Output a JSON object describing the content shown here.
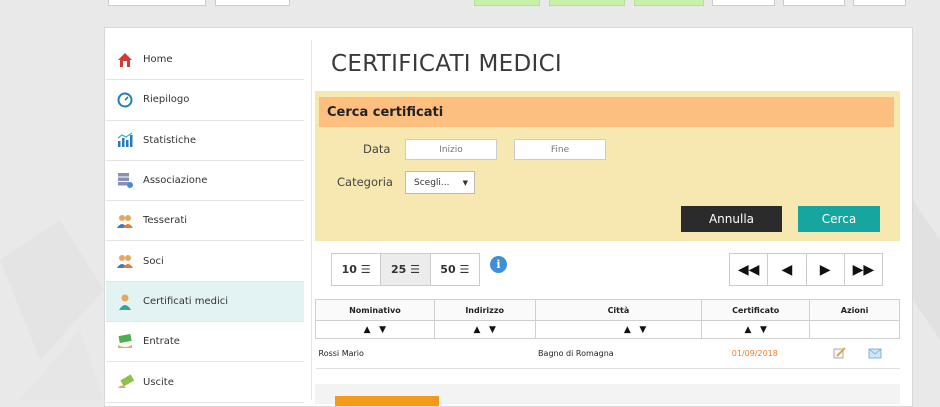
{
  "page_title": "CERTIFICATI MEDICI",
  "sidebar": {
    "items": [
      {
        "label": "Home",
        "icon": "home-icon"
      },
      {
        "label": "Riepilogo",
        "icon": "speedometer-icon"
      },
      {
        "label": "Statistiche",
        "icon": "bar-chart-icon"
      },
      {
        "label": "Associazione",
        "icon": "server-gear-icon"
      },
      {
        "label": "Tesserati",
        "icon": "users-icon"
      },
      {
        "label": "Soci",
        "icon": "users-icon"
      },
      {
        "label": "Certificati medici",
        "icon": "doctor-icon",
        "active": true
      },
      {
        "label": "Entrate",
        "icon": "money-in-icon"
      },
      {
        "label": "Uscite",
        "icon": "money-out-icon"
      }
    ]
  },
  "search": {
    "title": "Cerca certificati",
    "data_label": "Data",
    "start_placeholder": "Inizio",
    "end_placeholder": "Fine",
    "category_label": "Categoria",
    "category_value": "Scegli...",
    "cancel_label": "Annulla",
    "search_label": "Cerca"
  },
  "page_size": {
    "options": [
      "10",
      "25",
      "50"
    ],
    "selected": "25"
  },
  "table": {
    "columns": [
      "Nominativo",
      "Indirizzo",
      "Città",
      "Certificato",
      "Azioni"
    ],
    "rows": [
      {
        "nominativo": "Rossi Mario",
        "indirizzo": "",
        "citta": "Bagno di Romagna",
        "certificato": "01/09/2018"
      }
    ]
  },
  "colors": {
    "accent": "#17a59f",
    "header_orange": "#fdbf80",
    "search_bg": "#f7e8b1",
    "date_color": "#f07b2b"
  }
}
